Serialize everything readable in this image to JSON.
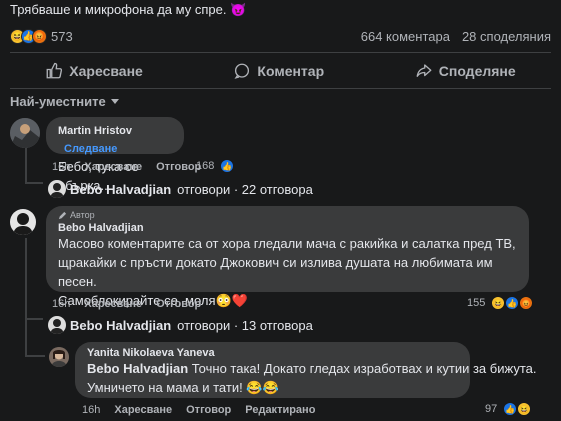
{
  "post": {
    "text_line1": "… … …",
    "text_line2": "Трябваше и микрофона да му спре. 😈",
    "reaction_count": "573",
    "comments_count": "664 коментара",
    "shares_count": "28 споделяния"
  },
  "actions": {
    "like": "Харесване",
    "comment": "Коментар",
    "share": "Споделяне"
  },
  "sort": {
    "label": "Най-уместните"
  },
  "comments": [
    {
      "author": "Martin Hristov",
      "follow": "Следване",
      "text": "Бебо, тука се объркa...",
      "time": "16h",
      "like": "Харесване",
      "reply": "Отговор",
      "likes": "168"
    },
    {
      "author": "Bebo Halvadjian",
      "badge": "Автор",
      "text1": "Масово коментарите са от хора гледали мача с ракийка и салатка пред ТВ,",
      "text2": "щракайки с пръсти докато Джокович си излива душата на любимата им песен.",
      "text3": "Самоблокирайте се, моля😳❤️",
      "time": "16h",
      "like": "Харесване",
      "reply": "Отговор",
      "likes": "155"
    },
    {
      "author": "Yanita Nikolaeva Yaneva",
      "mention": "Bebo Halvadjian",
      "text1": " Точно така! Докато гледах изработвах и кутии за бижута.",
      "text2": "Умничето на мама и тати! 😂😂",
      "time": "16h",
      "like": "Харесване",
      "reply": "Отговор",
      "edited": "Редактирано",
      "likes": "97"
    }
  ],
  "reply_threads": [
    {
      "name": "Bebo Halvadjian",
      "rest": "отговори · 22 отговора"
    },
    {
      "name": "Bebo Halvadjian",
      "rest": "отговори · 13 отговора"
    }
  ]
}
